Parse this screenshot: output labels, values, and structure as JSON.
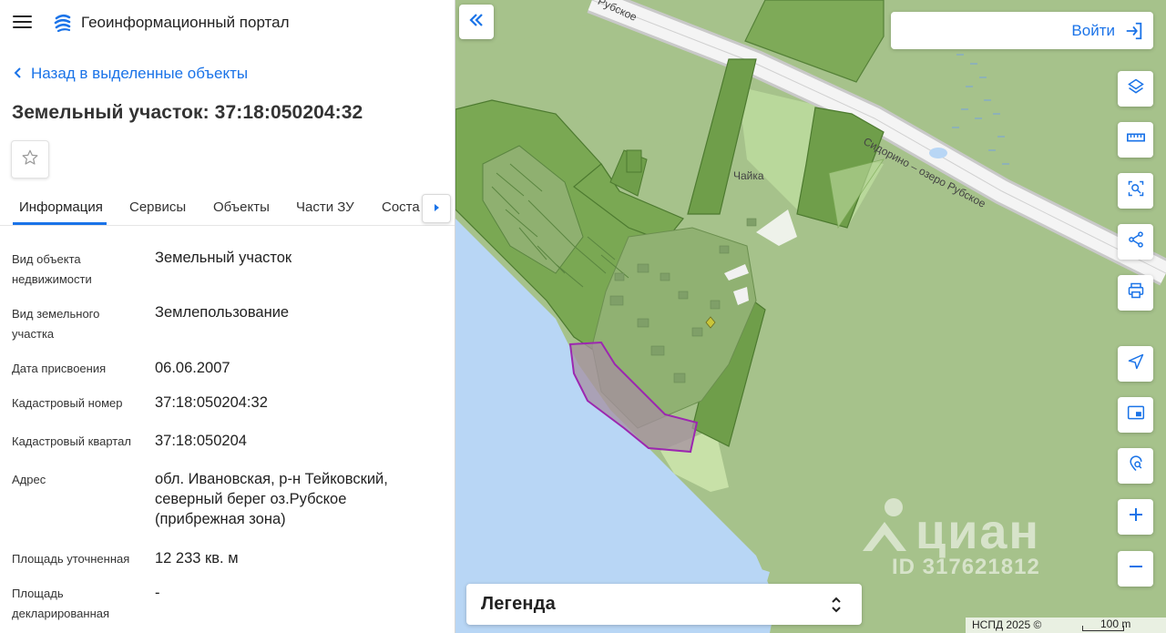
{
  "app": {
    "title": "Геоинформационный портал",
    "back_label": "Назад в выделенные объекты",
    "page_title": "Земельный участок: 37:18:050204:32"
  },
  "tabs": [
    {
      "label": "Информация",
      "active": true
    },
    {
      "label": "Сервисы"
    },
    {
      "label": "Объекты"
    },
    {
      "label": "Части ЗУ"
    },
    {
      "label": "Соста"
    }
  ],
  "details": [
    {
      "label": "Вид объекта недвижимости",
      "value": "Земельный участок"
    },
    {
      "label": "Вид земельного участка",
      "value": "Землепользование"
    },
    {
      "label": "Дата присвоения",
      "value": "06.06.2007"
    },
    {
      "label": "Кадастровый номер",
      "value": "37:18:050204:32"
    },
    {
      "label": "Кадастровый квартал",
      "value": "37:18:050204"
    },
    {
      "label": "Адрес",
      "value": "обл. Ивановская, р-н Тейковский, северный берег оз.Рубское (прибрежная зона)"
    },
    {
      "label": "Площадь уточненная",
      "value": "12 233 кв. м"
    },
    {
      "label": "Площадь декларированная",
      "value": "-"
    }
  ],
  "map": {
    "login_label": "Войти",
    "legend_label": "Легенда",
    "attribution": "НСПД 2025 ©",
    "scale_label": "100 m",
    "place_labels": {
      "village": "Чайка",
      "road_1": "Сидорино – озеро Рубское",
      "road_2": "Рубское"
    },
    "watermark": {
      "brand": "циан",
      "id": "ID 317621812"
    },
    "tools": [
      "layers-icon",
      "ruler-icon",
      "select-area-icon",
      "share-icon",
      "print-icon",
      "navigate-icon",
      "picture-in-picture-icon",
      "location-search-icon",
      "zoom-in-icon",
      "zoom-out-icon"
    ]
  },
  "colors": {
    "accent": "#1a73e8",
    "parcel_outline": "#9c27b0",
    "water": "#b8d6f5",
    "forest": "#a9c38f"
  }
}
